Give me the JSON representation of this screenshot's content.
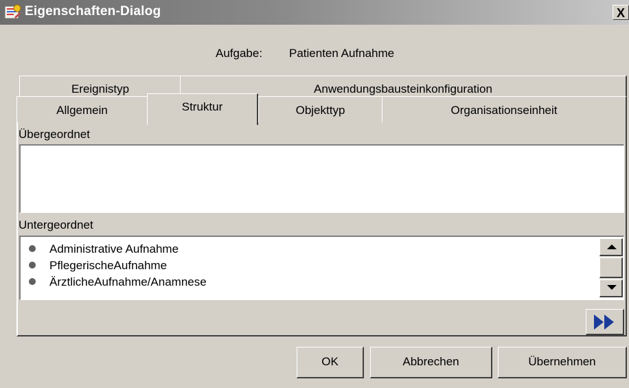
{
  "window": {
    "title": "Eigenschaften-Dialog",
    "close_glyph": "X"
  },
  "task": {
    "label": "Aufgabe:",
    "value": "Patienten Aufnahme"
  },
  "tabs_back": [
    "Ereignistyp",
    "Anwendungsbausteinkonfiguration"
  ],
  "tabs_front": [
    "Allgemein",
    "Struktur",
    "Objekttyp",
    "Organisationseinheit"
  ],
  "active_tab": "Struktur",
  "sections": {
    "parent_label": "Übergeordnet",
    "child_label": "Untergeordnet"
  },
  "child_items": [
    "Administrative Aufnahme",
    "PflegerischeAufnahme",
    "ÄrztlicheAufnahme/Anamnese"
  ],
  "buttons": {
    "ok": "OK",
    "cancel": "Abbrechen",
    "apply": "Übernehmen"
  },
  "colors": {
    "dialog_bg": "#d4d0c8",
    "titlebar_start": "#6d6d6d",
    "titlebar_end": "#c8c8c8",
    "move_arrow": "#1a3b9a"
  },
  "icons": {
    "app": "properties-icon",
    "close": "close-icon",
    "move": "double-arrow-right-icon"
  }
}
